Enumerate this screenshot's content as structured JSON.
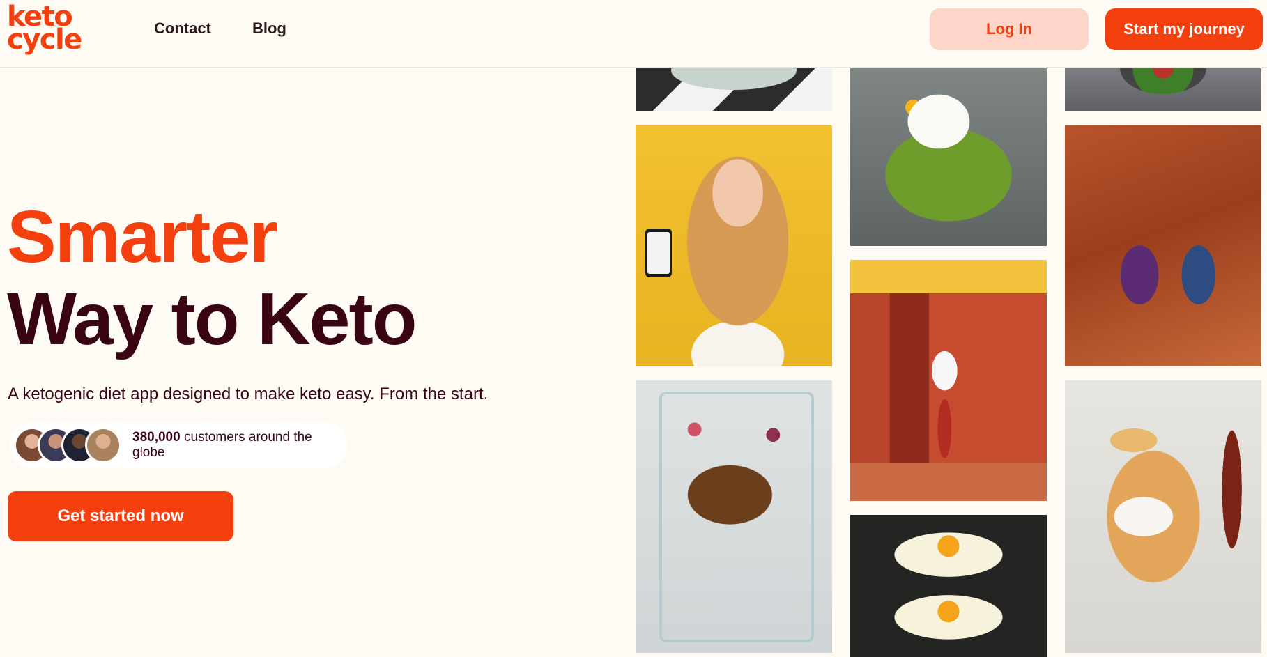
{
  "brand": {
    "logo_line1": "keto",
    "logo_line2": "cycle",
    "accent": "#f4400f",
    "dark": "#3a0512"
  },
  "nav": {
    "items": [
      "Contact",
      "Blog"
    ]
  },
  "header_buttons": {
    "login": "Log In",
    "start": "Start my journey"
  },
  "hero": {
    "line1": "Smarter",
    "line2": "Way to Keto",
    "subtitle": "A ketogenic diet app designed to make keto easy. From the start."
  },
  "social_proof": {
    "count": "380,000",
    "text": "customers around the globe"
  },
  "cta": {
    "label": "Get started now"
  }
}
